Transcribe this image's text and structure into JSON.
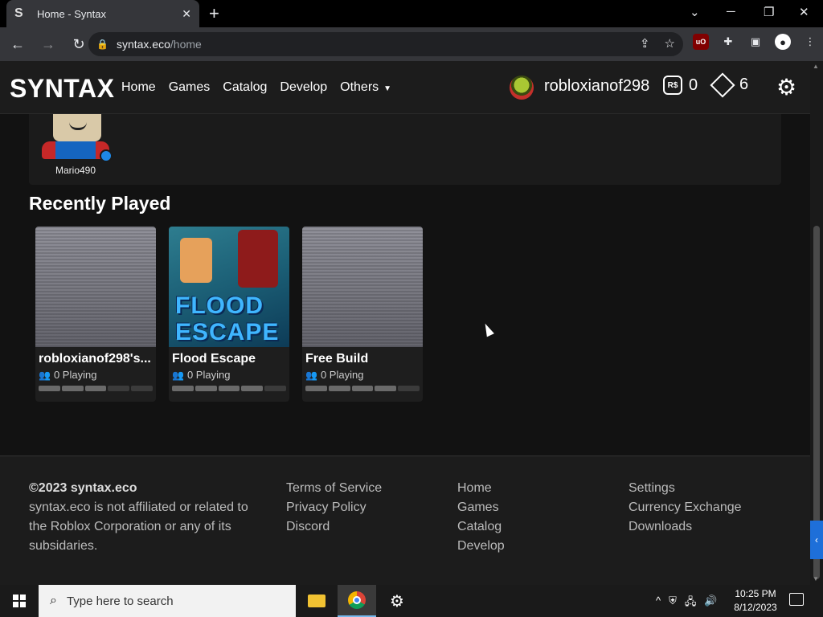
{
  "browser": {
    "tab_title": "Home - Syntax",
    "tab_favicon": "S",
    "url_host": "syntax.eco",
    "url_path": "/home"
  },
  "site": {
    "logo": "SYNTAX",
    "nav": {
      "home": "Home",
      "games": "Games",
      "catalog": "Catalog",
      "develop": "Develop",
      "others": "Others"
    },
    "user": {
      "name": "robloxianof298",
      "robux": "0",
      "tix": "6"
    }
  },
  "friends": [
    {
      "name": "Mario490"
    }
  ],
  "recently_played": {
    "title": "Recently Played",
    "games": [
      {
        "name": "robloxianof298's...",
        "playing": "0 Playing",
        "rating": 0.72
      },
      {
        "name": "Flood Escape",
        "playing": "0 Playing",
        "rating": 0.9
      },
      {
        "name": "Free Build",
        "playing": "0 Playing",
        "rating": 0.8
      }
    ]
  },
  "footer": {
    "copyright": "©2023 syntax.eco",
    "disclaimer": "syntax.eco is not affiliated or related to the Roblox Corporation or any of its subsidaries.",
    "col2": [
      "Terms of Service",
      "Privacy Policy",
      "Discord"
    ],
    "col3": [
      "Home",
      "Games",
      "Catalog",
      "Develop"
    ],
    "col4": [
      "Settings",
      "Currency Exchange",
      "Downloads"
    ]
  },
  "taskbar": {
    "search_placeholder": "Type here to search",
    "time": "10:25 PM",
    "date": "8/12/2023"
  },
  "thumbnails": {
    "flood_text": "FLOOD ESCAPE"
  },
  "colors": {
    "accent_blue": "#1e88e5",
    "background": "#121212"
  }
}
